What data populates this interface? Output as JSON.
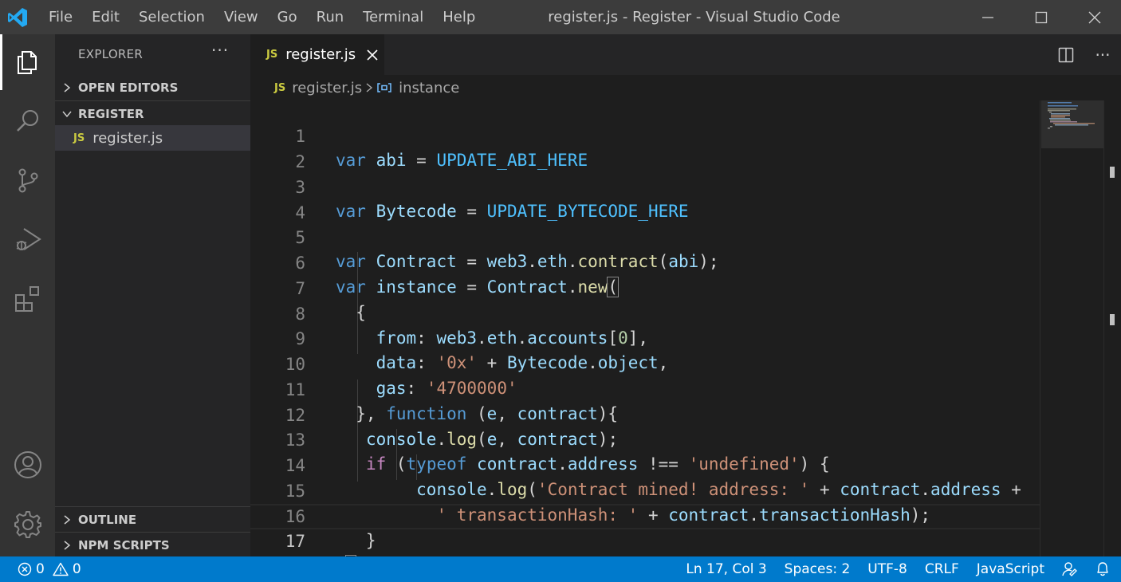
{
  "titlebar": {
    "menus": [
      "File",
      "Edit",
      "Selection",
      "View",
      "Go",
      "Run",
      "Terminal",
      "Help"
    ],
    "title": "register.js - Register - Visual Studio Code"
  },
  "activitybar": {
    "icons": [
      "explorer-icon",
      "search-icon",
      "source-control-icon",
      "run-debug-icon",
      "extensions-icon",
      "accounts-icon",
      "settings-gear-icon"
    ]
  },
  "sidebar": {
    "title": "EXPLORER",
    "more": "···",
    "open_editors": "OPEN EDITORS",
    "folder": "REGISTER",
    "file_badge": "JS",
    "file": "register.js",
    "outline": "OUTLINE",
    "npm_scripts": "NPM SCRIPTS"
  },
  "tabs": {
    "badge": "JS",
    "active_label": "register.js",
    "more": "···"
  },
  "breadcrumbs": {
    "badge": "JS",
    "file": "register.js",
    "symbol": "instance"
  },
  "editor": {
    "current_line": 17,
    "lines": [
      {
        "n": "1"
      },
      {
        "n": "2"
      },
      {
        "n": "3"
      },
      {
        "n": "4"
      },
      {
        "n": "5"
      },
      {
        "n": "6"
      },
      {
        "n": "7"
      },
      {
        "n": "8"
      },
      {
        "n": "9"
      },
      {
        "n": "10"
      },
      {
        "n": "11"
      },
      {
        "n": "12"
      },
      {
        "n": "13"
      },
      {
        "n": "14"
      },
      {
        "n": "15"
      },
      {
        "n": "16"
      },
      {
        "n": "17"
      }
    ],
    "tokens": {
      "l1": [
        "var",
        " abi",
        " = ",
        "UPDATE_ABI_HERE"
      ],
      "l3": [
        "var",
        " Bytecode",
        " = ",
        "UPDATE_BYTECODE_HERE"
      ],
      "l5": [
        "var",
        " Contract",
        " = ",
        "web3",
        ".",
        "eth",
        ".",
        "contract",
        "(",
        "abi",
        ");"
      ],
      "l6": [
        "var",
        " instance",
        " = ",
        "Contract",
        ".",
        "new",
        "("
      ],
      "l7": [
        "  {"
      ],
      "l8": [
        "    ",
        "from",
        ": ",
        "web3",
        ".",
        "eth",
        ".",
        "accounts",
        "[",
        "0",
        "],"
      ],
      "l9": [
        "    ",
        "data",
        ": ",
        "'0x'",
        " + ",
        "Bytecode",
        ".",
        "object",
        ","
      ],
      "l10": [
        "    ",
        "gas",
        ": ",
        "'4700000'"
      ],
      "l11": [
        "  }, ",
        "function",
        " (",
        "e",
        ", ",
        "contract",
        "){"
      ],
      "l12": [
        "   ",
        "console",
        ".",
        "log",
        "(",
        "e",
        ", ",
        "contract",
        ");"
      ],
      "l13": [
        "   ",
        "if",
        " (",
        "typeof",
        " ",
        "contract",
        ".",
        "address",
        " !== ",
        "'undefined'",
        ") {"
      ],
      "l14": [
        "        ",
        "console",
        ".",
        "log",
        "(",
        "'Contract mined! address: '",
        " + ",
        "contract",
        ".",
        "address",
        " +"
      ],
      "l15": [
        "          ",
        "' transactionHash: '",
        " + ",
        "contract",
        ".",
        "transactionHash",
        ");"
      ],
      "l16": [
        "   }"
      ],
      "l17": [
        "}",
        ")"
      ]
    }
  },
  "statusbar": {
    "errors": "0",
    "warnings": "0",
    "position": "Ln 17, Col 3",
    "spaces": "Spaces: 2",
    "encoding": "UTF-8",
    "eol": "CRLF",
    "language": "JavaScript"
  },
  "colors": {
    "accent": "#007acc",
    "keyword": "#569cd6",
    "variable": "#9cdcfe",
    "constant": "#4fc1ff",
    "function": "#dcdcaa",
    "string": "#ce9178",
    "number": "#b5cea8",
    "control": "#c586c0"
  }
}
